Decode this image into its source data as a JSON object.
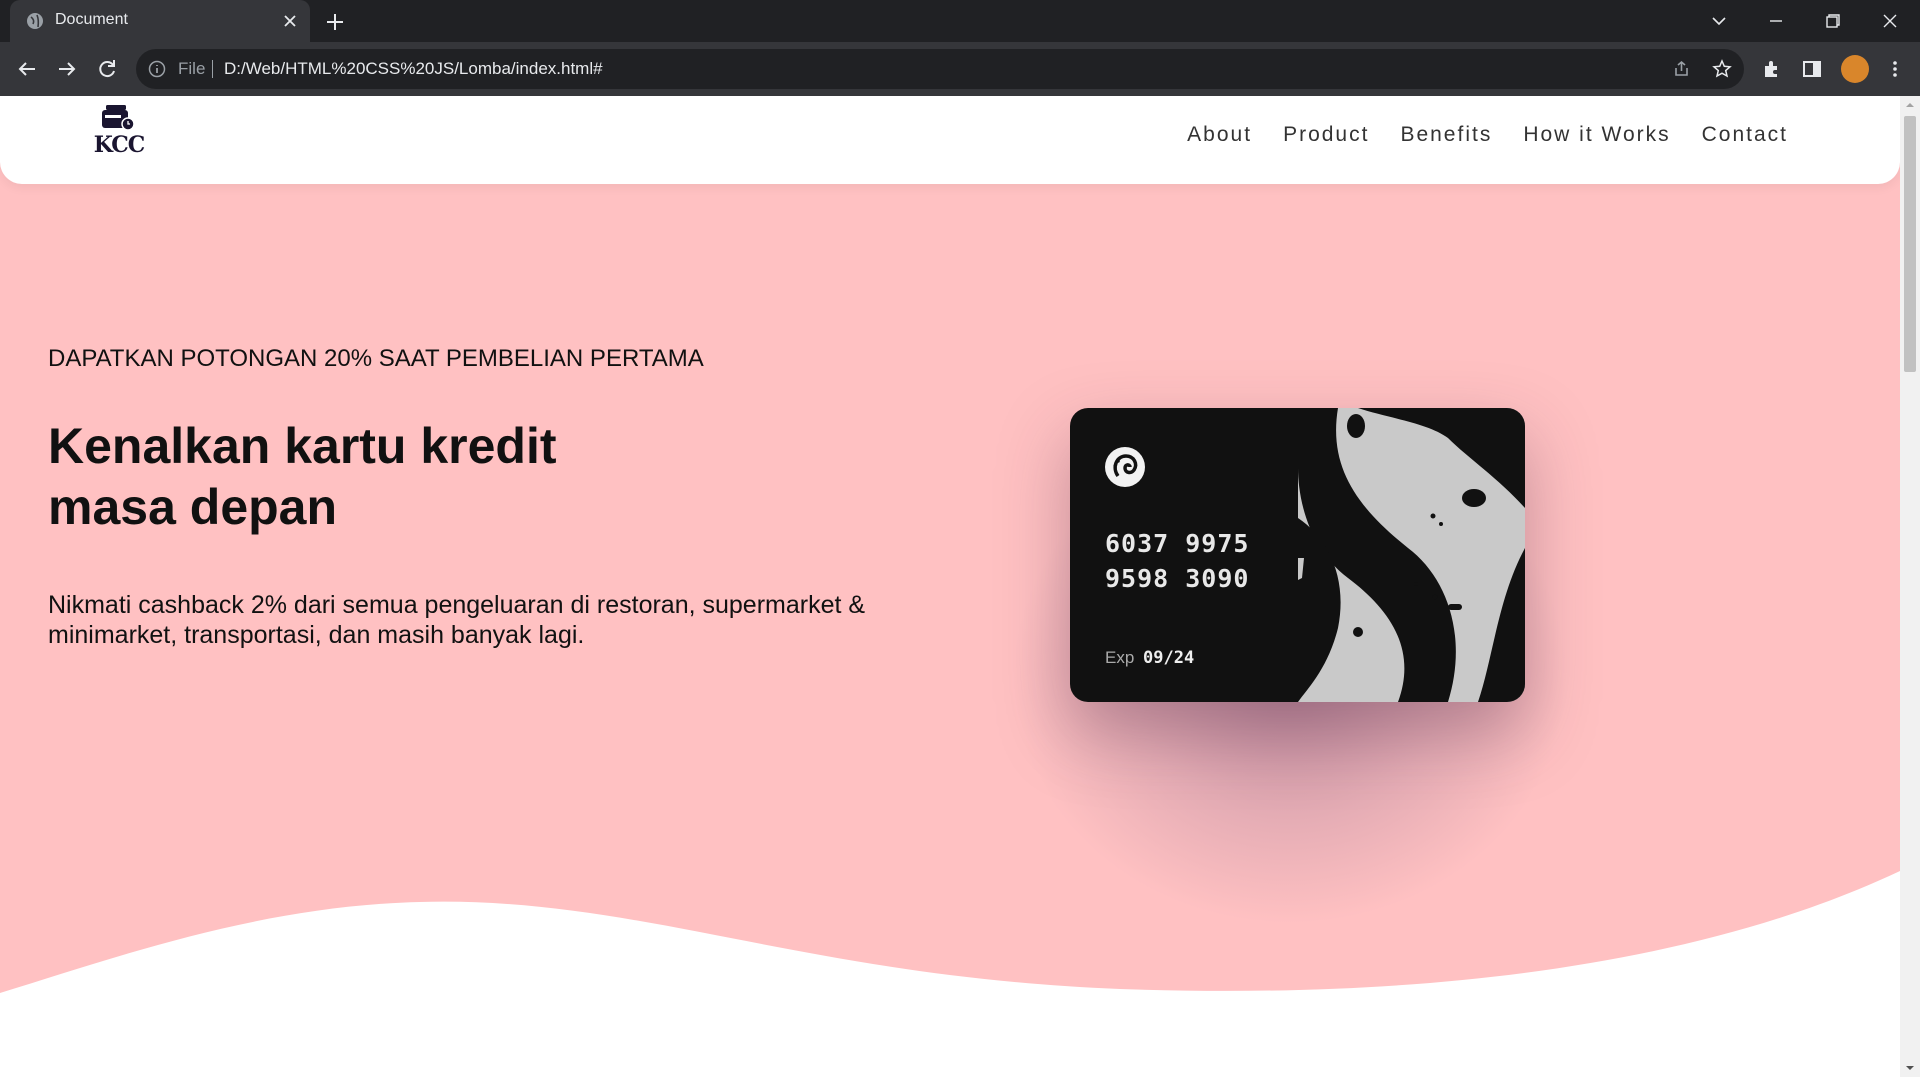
{
  "browser": {
    "tab_title": "Document",
    "url_scheme": "File",
    "url": "D:/Web/HTML%20CSS%20JS/Lomba/index.html#"
  },
  "site": {
    "logo_text": "KCC",
    "nav": [
      "About",
      "Product",
      "Benefits",
      "How it Works",
      "Contact"
    ]
  },
  "hero": {
    "eyebrow": "DAPATKAN POTONGAN 20% SAAT PEMBELIAN PERTAMA",
    "title": "Kenalkan kartu kredit masa depan",
    "description": "Nikmati cashback 2% dari semua pengeluaran di restoran, supermarket & minimarket, transportasi, dan masih banyak lagi."
  },
  "card": {
    "number_line1": "6037 9975",
    "number_line2": "9598 3090",
    "exp_label": "Exp",
    "exp_value": "09/24"
  },
  "colors": {
    "hero_bg": "#ffc1c2",
    "card_bg": "#111111",
    "card_pattern": "#c9c9c9"
  }
}
